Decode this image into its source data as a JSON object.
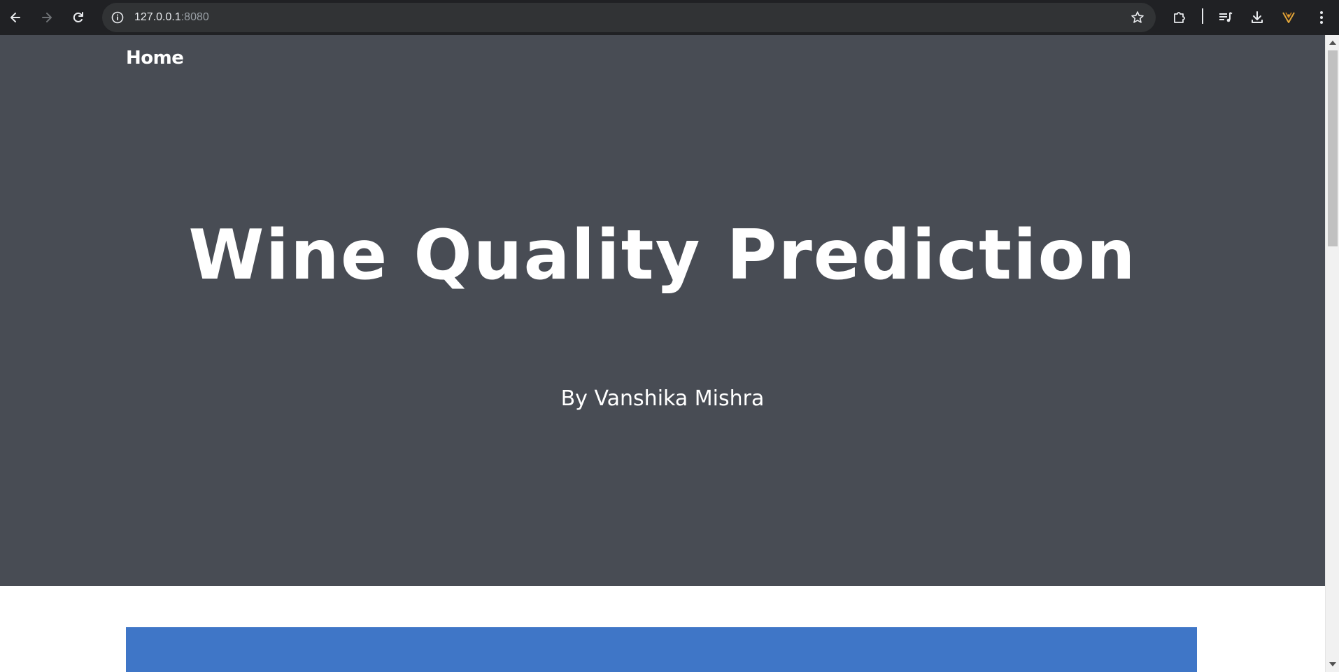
{
  "browser": {
    "url_host": "127.0.0.1",
    "url_port": ":8080",
    "icons": {
      "back": "arrow-left-icon",
      "forward": "arrow-right-icon",
      "reload": "reload-icon",
      "site_info": "info-icon",
      "bookmark": "star-icon",
      "extensions": "puzzle-icon",
      "media": "media-playlist-icon",
      "downloads": "download-icon",
      "profile": "extension-logo-icon",
      "menu": "kebab-menu-icon"
    }
  },
  "page": {
    "nav": {
      "home_label": "Home"
    },
    "hero": {
      "title": "Wine Quality Prediction",
      "subtitle": "By Vanshika Mishra"
    },
    "colors": {
      "hero_bg": "#484c54",
      "panel_bg": "#3f76c7",
      "text": "#ffffff"
    }
  }
}
